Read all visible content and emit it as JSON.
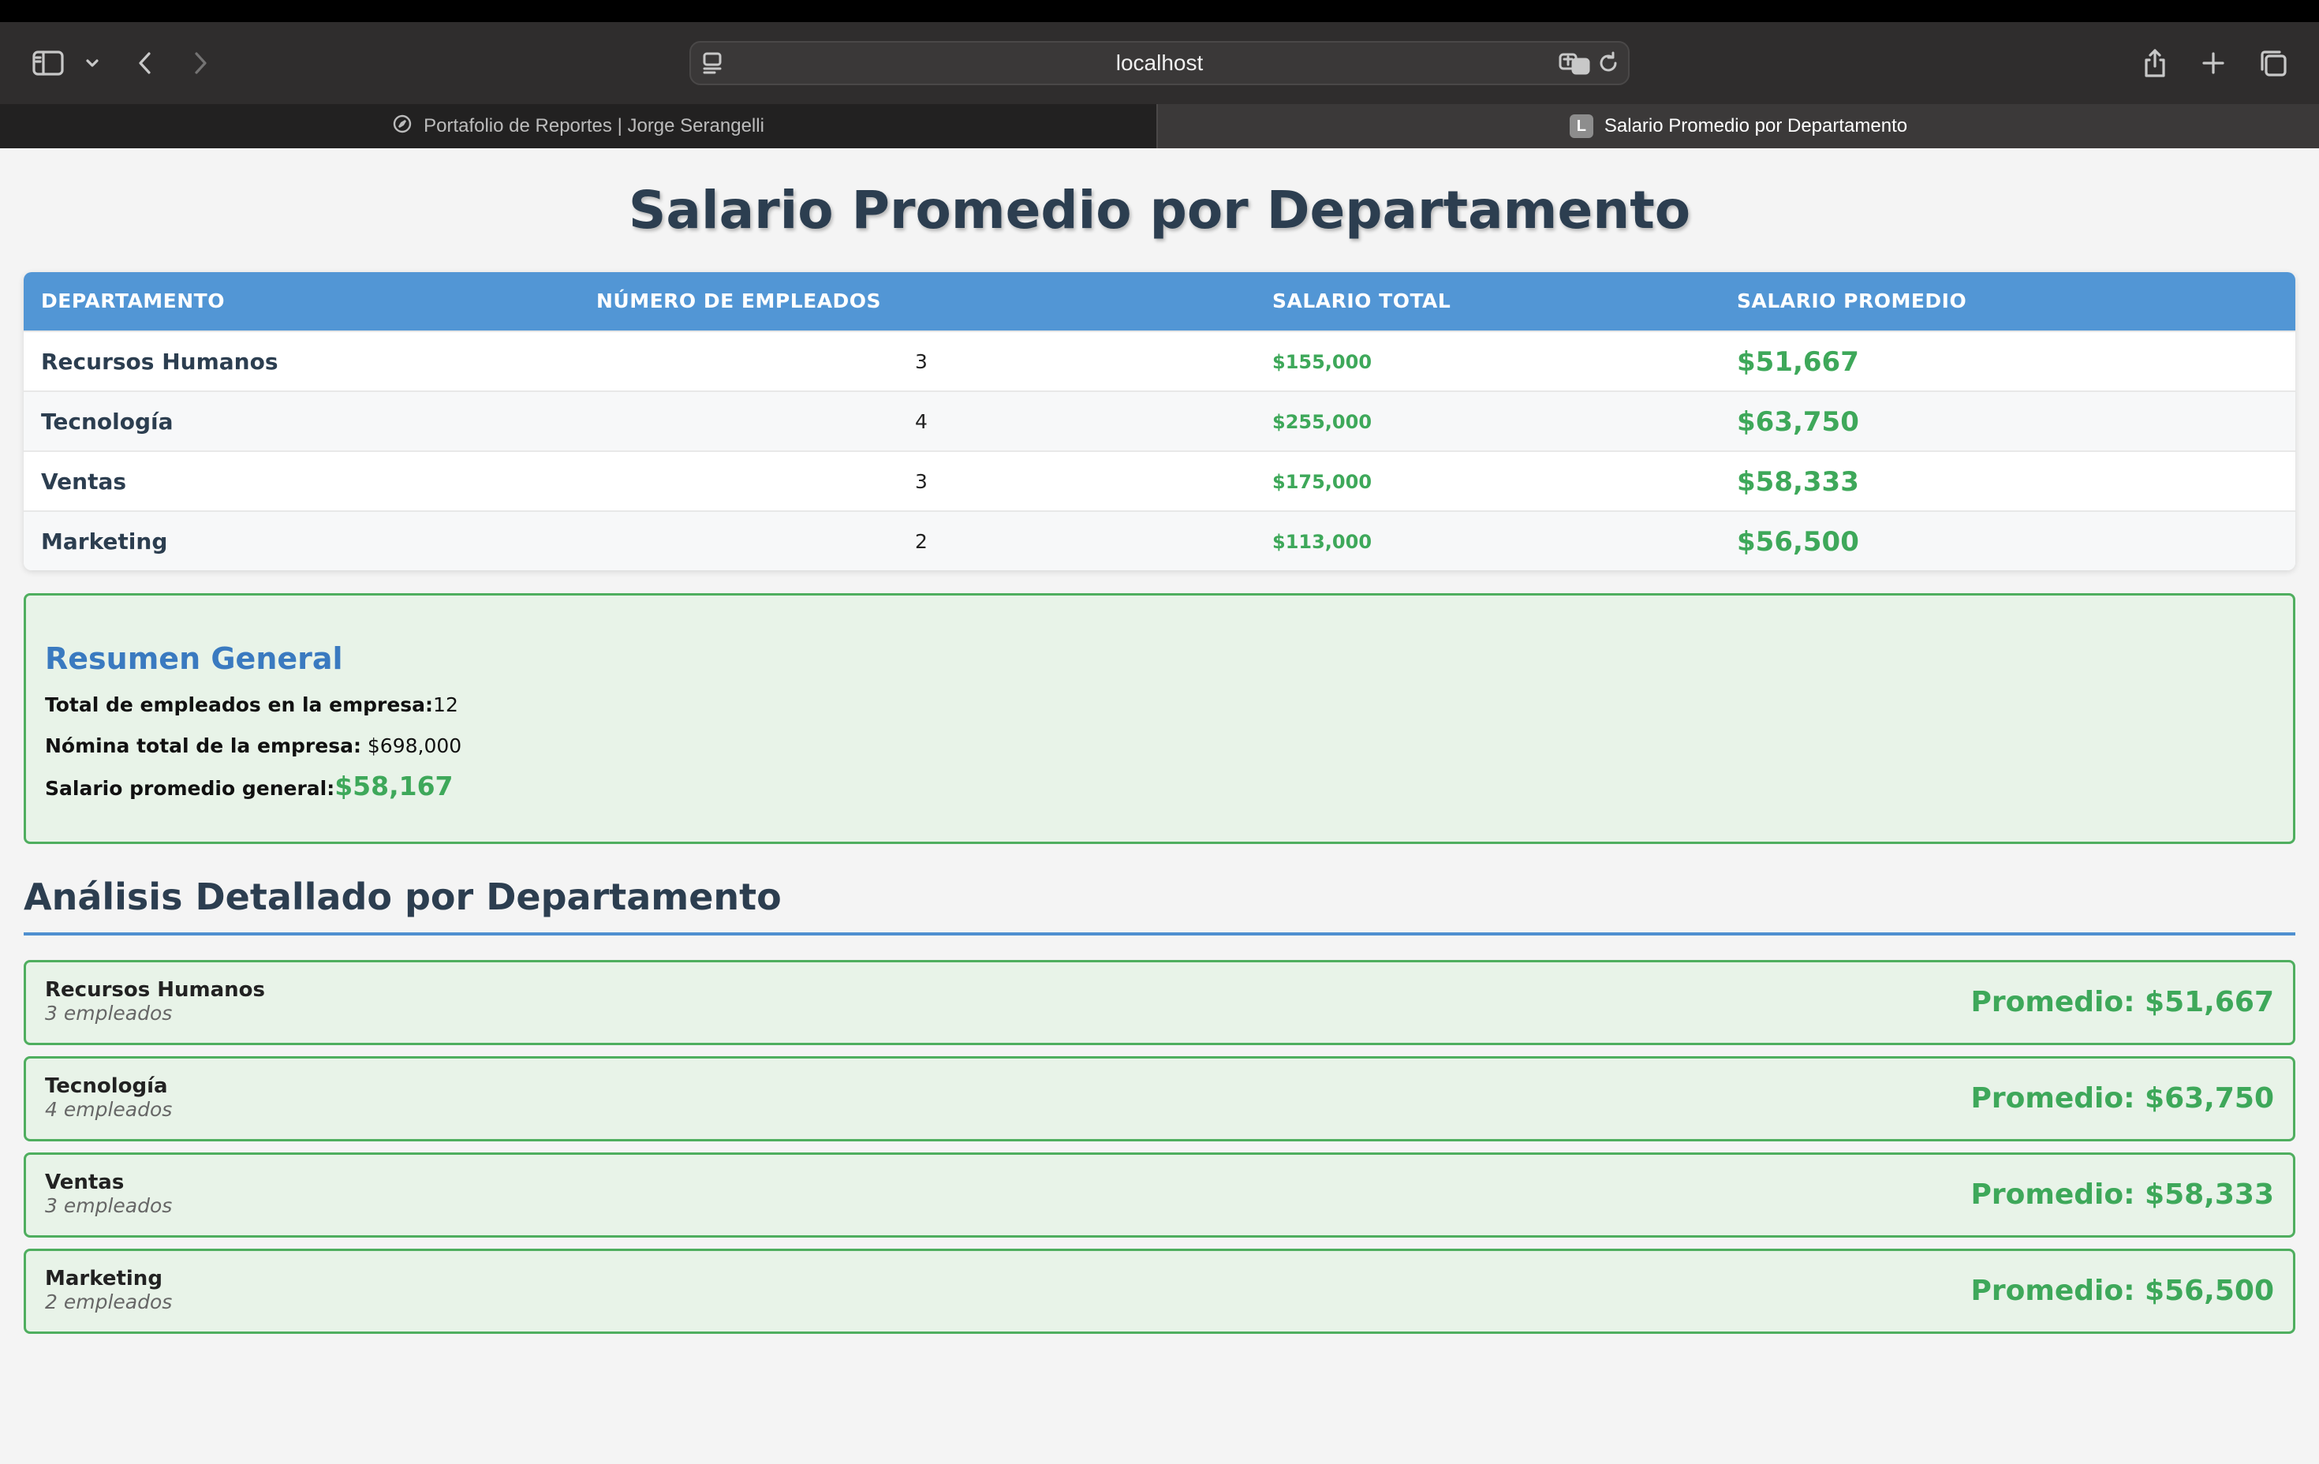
{
  "browser": {
    "url": "localhost",
    "tabs": [
      {
        "label": "Portafolio de Reportes | Jorge Serangelli",
        "active": false
      },
      {
        "label": "Salario Promedio por Departamento",
        "active": true,
        "favicon_letter": "L"
      }
    ]
  },
  "page": {
    "title": "Salario Promedio por Departamento",
    "table": {
      "headers": [
        "DEPARTAMENTO",
        "NÚMERO DE EMPLEADOS",
        "SALARIO TOTAL",
        "SALARIO PROMEDIO"
      ],
      "rows": [
        {
          "department": "Recursos Humanos",
          "employees": "3",
          "total": "$155,000",
          "average": "$51,667"
        },
        {
          "department": "Tecnología",
          "employees": "4",
          "total": "$255,000",
          "average": "$63,750"
        },
        {
          "department": "Ventas",
          "employees": "3",
          "total": "$175,000",
          "average": "$58,333"
        },
        {
          "department": "Marketing",
          "employees": "2",
          "total": "$113,000",
          "average": "$56,500"
        }
      ]
    },
    "summary": {
      "title": "Resumen General",
      "total_employees_label": "Total de empleados en la empresa:",
      "total_employees_value": "12",
      "payroll_label": "Nómina total de la empresa:",
      "payroll_value": "$698,000",
      "avg_label": "Salario promedio general:",
      "avg_value": "$58,167"
    },
    "analysis": {
      "title": "Análisis Detallado por Departamento",
      "cards": [
        {
          "name": "Recursos Humanos",
          "sub": "3 empleados",
          "avg": "Promedio: $51,667"
        },
        {
          "name": "Tecnología",
          "sub": "4 empleados",
          "avg": "Promedio: $63,750"
        },
        {
          "name": "Ventas",
          "sub": "3 empleados",
          "avg": "Promedio: $58,333"
        },
        {
          "name": "Marketing",
          "sub": "2 empleados",
          "avg": "Promedio: $56,500"
        }
      ]
    }
  },
  "colors": {
    "header_blue": "#5296d5",
    "accent_green": "#3ea85a",
    "title_dark": "#2c3e50",
    "summary_title_blue": "#3a7ac0"
  }
}
